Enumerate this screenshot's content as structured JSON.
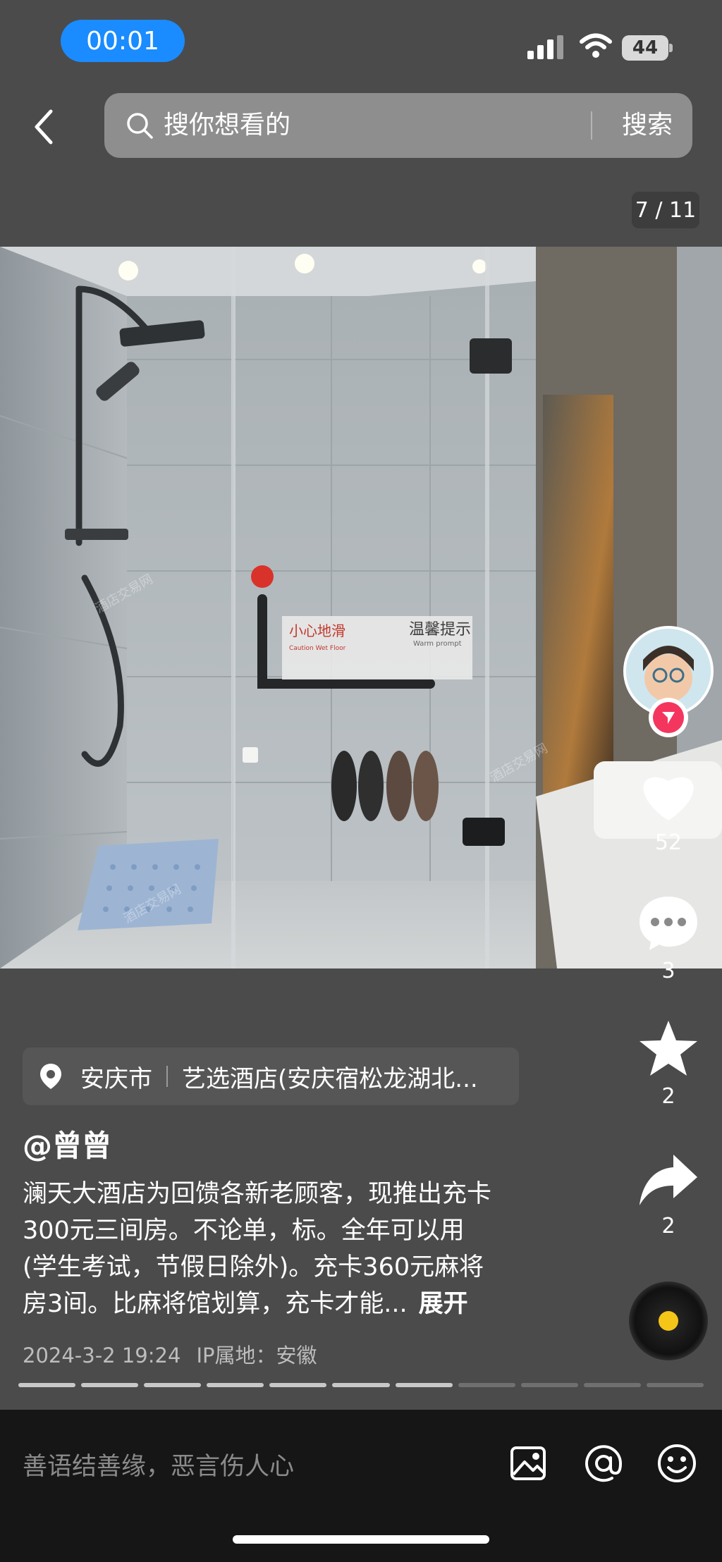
{
  "status_bar": {
    "time": "00:01",
    "battery": "44"
  },
  "search": {
    "placeholder": "搜你想看的",
    "button_label": "搜索"
  },
  "gallery": {
    "counter": "7 / 11",
    "total": 11,
    "current": 7
  },
  "actions": {
    "likes": "52",
    "comments": "3",
    "favorites": "2",
    "shares": "2"
  },
  "location": {
    "city": "安庆市",
    "hotel": "艺选酒店(安庆宿松龙湖北..."
  },
  "post": {
    "author": "@曾曾",
    "description_lines": [
      "澜天大酒店为回馈各新老顾客，现推出充卡",
      "300元三间房。不论单，标。全年可以用",
      "(学生考试，节假日除外)。充卡360元麻将",
      "房3间。比麻将馆划算，充卡才能..."
    ],
    "expand_label": "展开",
    "date": "2024-3-2 19:24",
    "ip_location": "IP属地：安徽"
  },
  "comment_bar": {
    "placeholder": "善语结善缘，恶言伤人心"
  },
  "photo_text": {
    "sign_title": "温馨提示",
    "sign_subtitle": "Warm prompt",
    "sign_warning": "小心地滑",
    "sign_warning_en": "Caution Wet Floor",
    "watermark": "酒店交易网",
    "watermark_url": "Jiudianrong.com"
  },
  "colors": {
    "accent": "#1a8cff",
    "follow": "#f4365f",
    "disc_dot": "#f5c518"
  }
}
